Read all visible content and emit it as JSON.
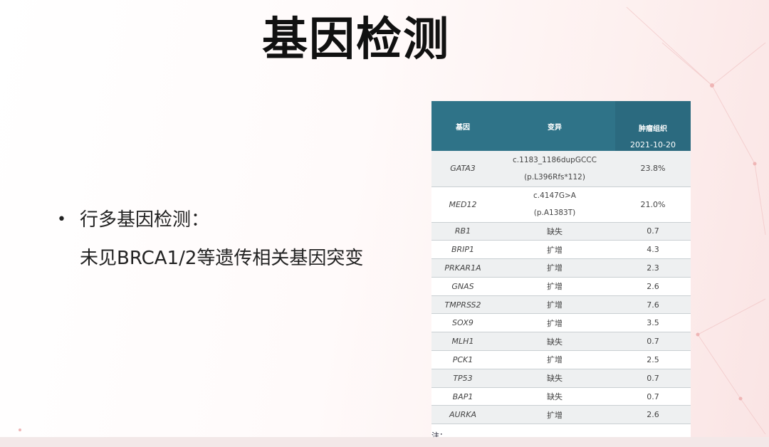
{
  "slide": {
    "title": "基因检测",
    "bullets": [
      {
        "marker": "•",
        "text": "行多基因检测："
      },
      {
        "marker": "",
        "text": "未见BRCA1/2等遗传相关基因突变"
      }
    ]
  },
  "table": {
    "headers": {
      "gene": "基因",
      "mutation": "变异",
      "tumor": "肿瘤组织",
      "date": "2021-10-20"
    },
    "rows": [
      {
        "gene": "GATA3",
        "mutation": [
          "c.1183_1186dupGCCC",
          "(p.L396Rfs*112)"
        ],
        "value": "23.8%"
      },
      {
        "gene": "MED12",
        "mutation": [
          "c.4147G>A",
          "(p.A1383T)"
        ],
        "value": "21.0%"
      },
      {
        "gene": "RB1",
        "mutation": [
          "缺失"
        ],
        "value": "0.7"
      },
      {
        "gene": "BRIP1",
        "mutation": [
          "扩增"
        ],
        "value": "4.3"
      },
      {
        "gene": "PRKAR1A",
        "mutation": [
          "扩增"
        ],
        "value": "2.3"
      },
      {
        "gene": "GNAS",
        "mutation": [
          "扩增"
        ],
        "value": "2.6"
      },
      {
        "gene": "TMPRSS2",
        "mutation": [
          "扩增"
        ],
        "value": "7.6"
      },
      {
        "gene": "SOX9",
        "mutation": [
          "扩增"
        ],
        "value": "3.5"
      },
      {
        "gene": "MLH1",
        "mutation": [
          "缺失"
        ],
        "value": "0.7"
      },
      {
        "gene": "PCK1",
        "mutation": [
          "扩增"
        ],
        "value": "2.5"
      },
      {
        "gene": "TP53",
        "mutation": [
          "缺失"
        ],
        "value": "0.7"
      },
      {
        "gene": "BAP1",
        "mutation": [
          "缺失"
        ],
        "value": "0.7"
      },
      {
        "gene": "AURKA",
        "mutation": [
          "扩增"
        ],
        "value": "2.6"
      }
    ],
    "note": "注："
  },
  "colors": {
    "header_bg": "#2f7388",
    "row_alt": "#eef0f1",
    "accent_bg": "#fae4e4"
  }
}
